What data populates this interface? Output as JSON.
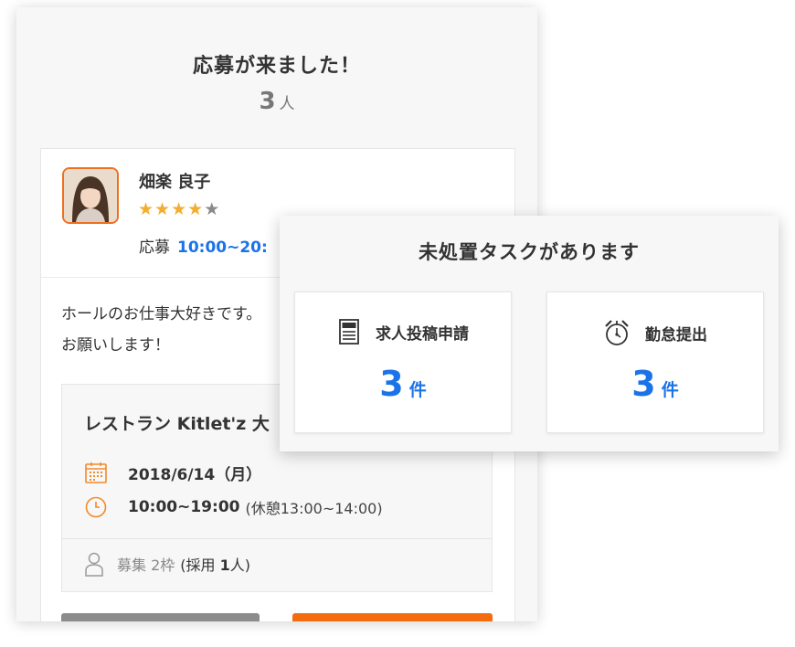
{
  "applications": {
    "title": "応募が来ました！",
    "count": "3",
    "count_unit": "人"
  },
  "applicant": {
    "name": "畑楽 良子",
    "rating": 4,
    "rating_max": 5,
    "applied_label": "応募",
    "applied_time": "10:00~20:",
    "message_line1": "ホールのお仕事大好きです。",
    "message_line2": "お願いします！"
  },
  "job": {
    "title": "レストラン Kitlet'z 大",
    "date": "2018/6/14（月）",
    "time": "10:00~19:00",
    "break": "(休憩13:00~14:00)",
    "recruit_text": "募集 2枠",
    "adopted_prefix": "(採用 ",
    "adopted_count": "1",
    "adopted_suffix": "人)"
  },
  "tasks": {
    "title": "未処置タスクがあります",
    "items": [
      {
        "label": "求人投稿申請",
        "count": "3",
        "unit": "件",
        "icon": "job-document-icon"
      },
      {
        "label": "勤怠提出",
        "count": "3",
        "unit": "件",
        "icon": "alarm-clock-icon"
      }
    ]
  },
  "colors": {
    "accent_blue": "#1a73e8",
    "accent_orange": "#f36d10",
    "star": "#f3ad2f"
  }
}
